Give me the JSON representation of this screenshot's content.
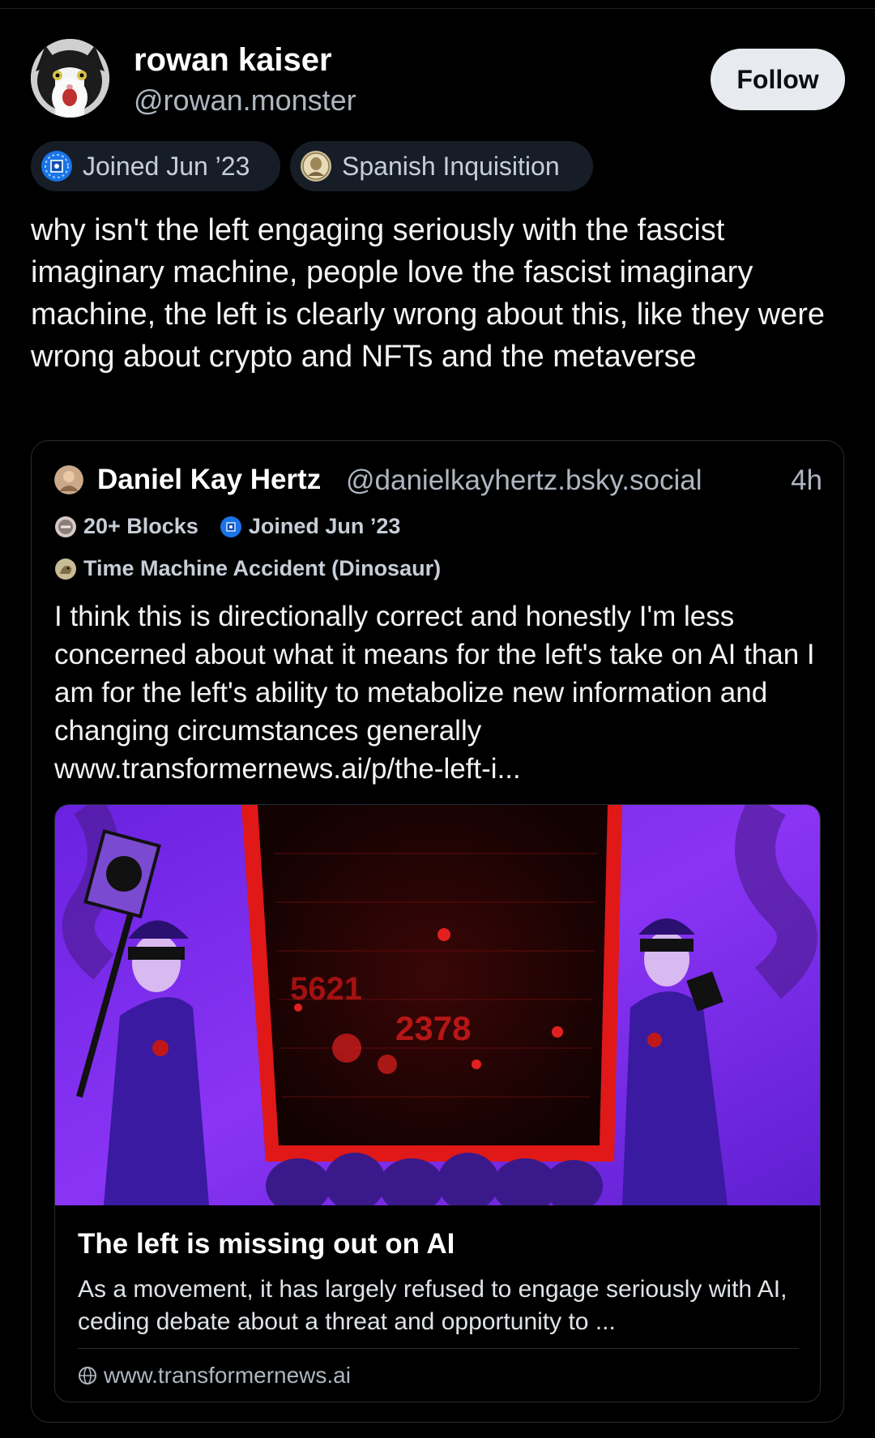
{
  "author": {
    "display_name": "rowan kaiser",
    "handle": "@rowan.monster",
    "avatar_icon": "cat-avatar",
    "follow_label": "Follow"
  },
  "badges": [
    {
      "label": "Joined Jun ’23",
      "icon": "joined-badge-icon"
    },
    {
      "label": "Spanish Inquisition",
      "icon": "inquisition-badge-icon"
    }
  ],
  "post": {
    "text": "why isn't the left engaging seriously with the fascist imaginary machine, people love the fascist imaginary machine, the left is clearly wrong about this, like they were wrong about crypto and NFTs and the metaverse"
  },
  "quote": {
    "display_name": "Daniel Kay Hertz",
    "handle": "@danielkayhertz.bsky.social",
    "time": "4h",
    "badges": [
      {
        "label": "20+ Blocks",
        "icon": "blocks-badge-icon"
      },
      {
        "label": "Joined Jun ’23",
        "icon": "joined-badge-icon"
      },
      {
        "label": "Time Machine Accident (Dinosaur)",
        "icon": "dinosaur-badge-icon"
      }
    ],
    "text": "I think this is directionally correct and honestly I'm less concerned about what it means for the left's take on AI than I am for the left's ability to metabolize new information and changing circumstances generally",
    "link_text": "www.transformernews.ai/p/the-left-i...",
    "card": {
      "image_text_1": "5621",
      "image_text_2": "2378",
      "title": "The left is missing out on AI",
      "description": "As a movement, it has largely refused to engage seriously with AI, ceding debate about a threat and opportunity to ...",
      "domain": "www.transformernews.ai"
    }
  },
  "colors": {
    "background": "#000000",
    "card_border": "#262c34",
    "badge_bg": "#161d27",
    "muted_text": "#aeb6c0",
    "accent_purple": "#7a2cf0",
    "accent_red": "#e01818"
  }
}
